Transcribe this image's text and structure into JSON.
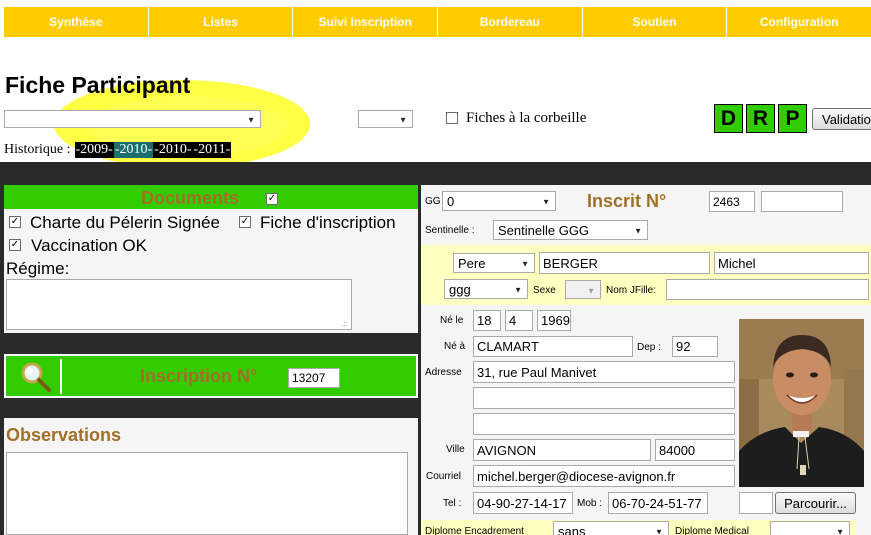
{
  "nav": {
    "tabs": [
      "Synthèse",
      "Listes",
      "Suivi Inscription",
      "Bordereau",
      "Soutien",
      "Configuration"
    ]
  },
  "page_title": "Fiche Participant",
  "toolbar": {
    "select1_value": "",
    "select2_value": "",
    "corbeille_label": "Fiches à la corbeille",
    "corbeille_checked": false,
    "drp": [
      "D",
      "R",
      "P"
    ],
    "validate_label": "Validation"
  },
  "historique": {
    "label": "Historique :",
    "years": [
      "-2009-",
      "-2010-",
      "-2010-",
      "-2011-"
    ]
  },
  "documents": {
    "title": "Documents",
    "checked": true,
    "charte_label": "Charte du Pélerin Signée",
    "fiche_label": "Fiche d'inscription",
    "vaccination_label": "Vaccination OK",
    "regime_label": "Régime:",
    "regime_value": ""
  },
  "inscription": {
    "label": "Inscription N°",
    "number": "13207"
  },
  "observations": {
    "title": "Observations",
    "value": ""
  },
  "participant": {
    "gg_label": "GG",
    "gg_value": "0",
    "inscrit_label": "Inscrit N°",
    "inscrit_number": "2463",
    "inscrit_extra": "",
    "sentinelle_label": "Sentinelle :",
    "sentinelle_value": "Sentinelle GGG",
    "civilite": "Pere",
    "nom": "BERGER",
    "prenom": "Michel",
    "groupe": "ggg",
    "sexe_label": "Sexe",
    "sexe_value": "",
    "nomjfille_label": "Nom JFille:",
    "nomjfille_value": "",
    "ne_le_label": "Né le",
    "ne_jour": "18",
    "ne_mois": "4",
    "ne_annee": "1969",
    "ne_a_label": "Né à",
    "ne_a_value": "CLAMART",
    "dep_label": "Dep :",
    "dep_value": "92",
    "adresse_label": "Adresse",
    "adresse1": "31, rue Paul Manivet",
    "adresse2": "",
    "adresse3": "",
    "ville_label": "Ville",
    "ville_value": "AVIGNON",
    "cp_value": "84000",
    "courriel_label": "Courriel",
    "courriel_value": "michel.berger@diocese-avignon.fr",
    "tel_label": "Tel :",
    "tel_value": "04-90-27-14-17",
    "mob_label": "Mob :",
    "mob_value": "06-70-24-51-77",
    "parcourir_label": "Parcourir...",
    "file_value": "",
    "diplome_encadrement_label": "Diplome Encadrement",
    "diplome_encadrement_value": "sans",
    "diplome_medical_label": "Diplome Medical",
    "diplome_medical_value": ""
  },
  "colors": {
    "nav": "#ffcc00",
    "green": "#33cc00",
    "brown": "#a0702a",
    "dark": "#2a2a2a",
    "yellow_band": "#ffffc0"
  }
}
